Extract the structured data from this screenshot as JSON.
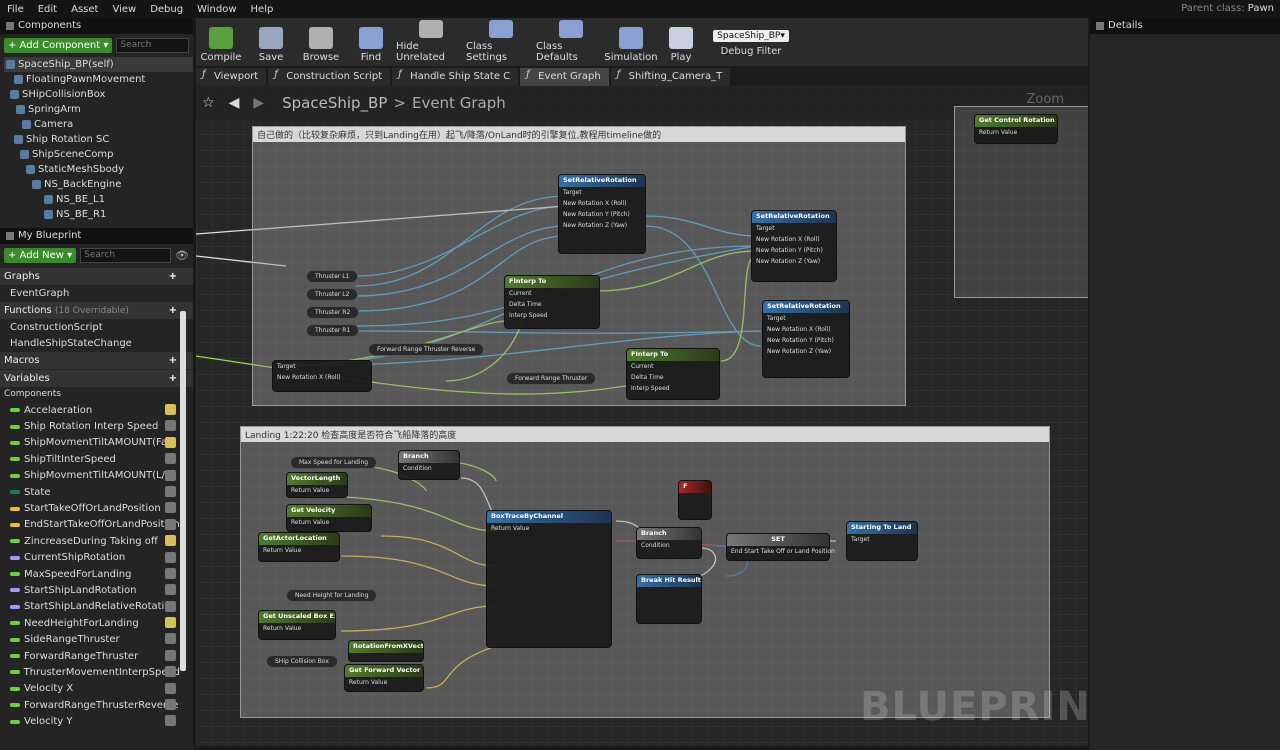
{
  "menu": [
    "File",
    "Edit",
    "Asset",
    "View",
    "Debug",
    "Window",
    "Help"
  ],
  "parent_class": {
    "label": "Parent class:",
    "value": "Pawn"
  },
  "components": {
    "tab": "Components",
    "add_label": "+ Add Component ▾",
    "search_placeholder": "Search",
    "tree": [
      "SpaceShip_BP(self)",
      "FloatingPawnMovement",
      "SHipCollisionBox",
      "SpringArm",
      "Camera",
      "Ship Rotation SC",
      "ShipSceneComp",
      "StaticMeshSbody",
      "NS_BackEngine",
      "NS_BE_L1",
      "NS_BE_R1"
    ]
  },
  "blueprint": {
    "tab": "My Blueprint",
    "add_label": "+ Add New ▾",
    "search_placeholder": "Search",
    "graphs_label": "Graphs",
    "graph_items": [
      "EventGraph"
    ],
    "functions_label": "Functions",
    "functions_note": "(18 Overridable)",
    "function_items": [
      "ConstructionScript",
      "HandleShipStateChange"
    ],
    "macros_label": "Macros",
    "variables_label": "Variables",
    "components_label": "Components",
    "variables": [
      {
        "name": "Accelaeration",
        "color": "#6fcf3f",
        "eye": true
      },
      {
        "name": "Ship Rotation Interp Speed",
        "color": "#6fcf3f",
        "eye": false
      },
      {
        "name": "ShipMovmentTiltAMOUNT(Fas",
        "color": "#6fcf3f",
        "eye": true
      },
      {
        "name": "ShipTiltInterSpeed",
        "color": "#6fcf3f",
        "eye": false
      },
      {
        "name": "ShipMovmentTiltAMOUNT(L/R",
        "color": "#6fcf3f",
        "eye": false
      },
      {
        "name": "State",
        "color": "#1a7a6a",
        "eye": false
      },
      {
        "name": "StartTakeOffOrLandPosition",
        "color": "#e8c030",
        "eye": false
      },
      {
        "name": "EndStartTakeOffOrLandPosition",
        "color": "#e8c030",
        "eye": false
      },
      {
        "name": "ZincreaseDuring Taking off",
        "color": "#6fcf3f",
        "eye": true
      },
      {
        "name": "CurrentShipRotation",
        "color": "#9aa0f8",
        "eye": false
      },
      {
        "name": "MaxSpeedForLanding",
        "color": "#6fcf3f",
        "eye": false
      },
      {
        "name": "StartShipLandRotation",
        "color": "#9aa0f8",
        "eye": false
      },
      {
        "name": "StartShipLandRelativeRotation",
        "color": "#9aa0f8",
        "eye": false
      },
      {
        "name": "NeedHeightForLanding",
        "color": "#6fcf3f",
        "eye": true
      },
      {
        "name": "SideRangeThruster",
        "color": "#6fcf3f",
        "eye": false
      },
      {
        "name": "ForwardRangeThruster",
        "color": "#6fcf3f",
        "eye": false
      },
      {
        "name": "ThrusterMovementInterpSpeed",
        "color": "#6fcf3f",
        "eye": false
      },
      {
        "name": "Velocity X",
        "color": "#6fcf3f",
        "eye": false
      },
      {
        "name": "ForwardRangeThrusterReverse",
        "color": "#6fcf3f",
        "eye": false
      },
      {
        "name": "Velocity Y",
        "color": "#6fcf3f",
        "eye": false
      }
    ]
  },
  "toolbar": [
    {
      "label": "Compile",
      "icon": "compile-icon",
      "color": "#5aa040"
    },
    {
      "label": "Save",
      "icon": "save-icon",
      "color": "#9aa5c0"
    },
    {
      "label": "Browse",
      "icon": "browse-icon",
      "color": "#b0b0b0"
    },
    {
      "label": "Find",
      "icon": "find-icon",
      "color": "#8aa0d0"
    },
    {
      "label": "Hide Unrelated",
      "icon": "hide-unrelated-icon",
      "color": "#b0b0b0"
    },
    {
      "label": "Class Settings",
      "icon": "class-settings-icon",
      "color": "#8aa0d0"
    },
    {
      "label": "Class Defaults",
      "icon": "class-defaults-icon",
      "color": "#8aa0d0"
    },
    {
      "label": "Simulation",
      "icon": "simulation-icon",
      "color": "#8aa0d0"
    },
    {
      "label": "Play",
      "icon": "play-icon",
      "color": "#c8d0e0"
    }
  ],
  "debug": {
    "selected": "SpaceShip_BP▾",
    "label": "Debug Filter"
  },
  "editor_tabs": [
    "Viewport",
    "Construction Script",
    "Handle Ship State C",
    "Event Graph",
    "Shifting_Camera_T"
  ],
  "graph": {
    "breadcrumb_root": "SpaceShip_BP",
    "breadcrumb_sep": ">",
    "breadcrumb_leaf": "Event Graph",
    "zoom": "Zoom",
    "comment1": "自己做的（比较复杂麻烦，只到Landing在用）起飞/降落/OnLand时的引擎复位,教程用timeline做的",
    "comment2": "Landing 1:22:20 检查高度是否符合飞船降落的高度",
    "watermark": "BLUEPRINT",
    "nodes": {
      "set_rel_rot": "SetRelativeRotation",
      "target_scene": "Target is Scene Component",
      "finterp": "FInterp To",
      "get_velocity": "Get Velocity",
      "get_actor_location": "GetActorLocation",
      "get_unscaled_box": "Get Unscaled Box Extent",
      "get_forward": "Get Forward Vector",
      "rot_from_x": "RotationFromXVector",
      "vector_length": "VectorLength",
      "branch": "Branch",
      "box_trace": "BoxTraceByChannel",
      "break_hit": "Break Hit Result",
      "set": "SET",
      "starting_to_land": "Starting To Land",
      "f": "F",
      "get_unit_rotation": "Get Control Rotation",
      "max_speed_var": "Max Speed for Landing",
      "need_height_var": "Need Height for Landing",
      "ship_box_var": "SHip Collision Box",
      "fwd_reverse_var": "Forward Range Thruster Reverse",
      "fwd_var": "Forward Range Thruster",
      "thrusters": [
        "Thruster L1",
        "Thruster L2",
        "Thruster R2",
        "Thruster R1"
      ],
      "pins": {
        "target": "Target",
        "current": "Current",
        "delta": "Delta Time",
        "interp": "Interp Speed",
        "ret": "Return Value",
        "cond": "Condition",
        "true": "True",
        "false": "False",
        "roll": "New Rotation X (Roll)",
        "pitch": "New Rotation Y (Pitch)",
        "yaw": "New Rotation Z (Yaw)",
        "end_start": "End Start Take Off or Land Position"
      }
    }
  },
  "details": {
    "tab": "Details"
  }
}
